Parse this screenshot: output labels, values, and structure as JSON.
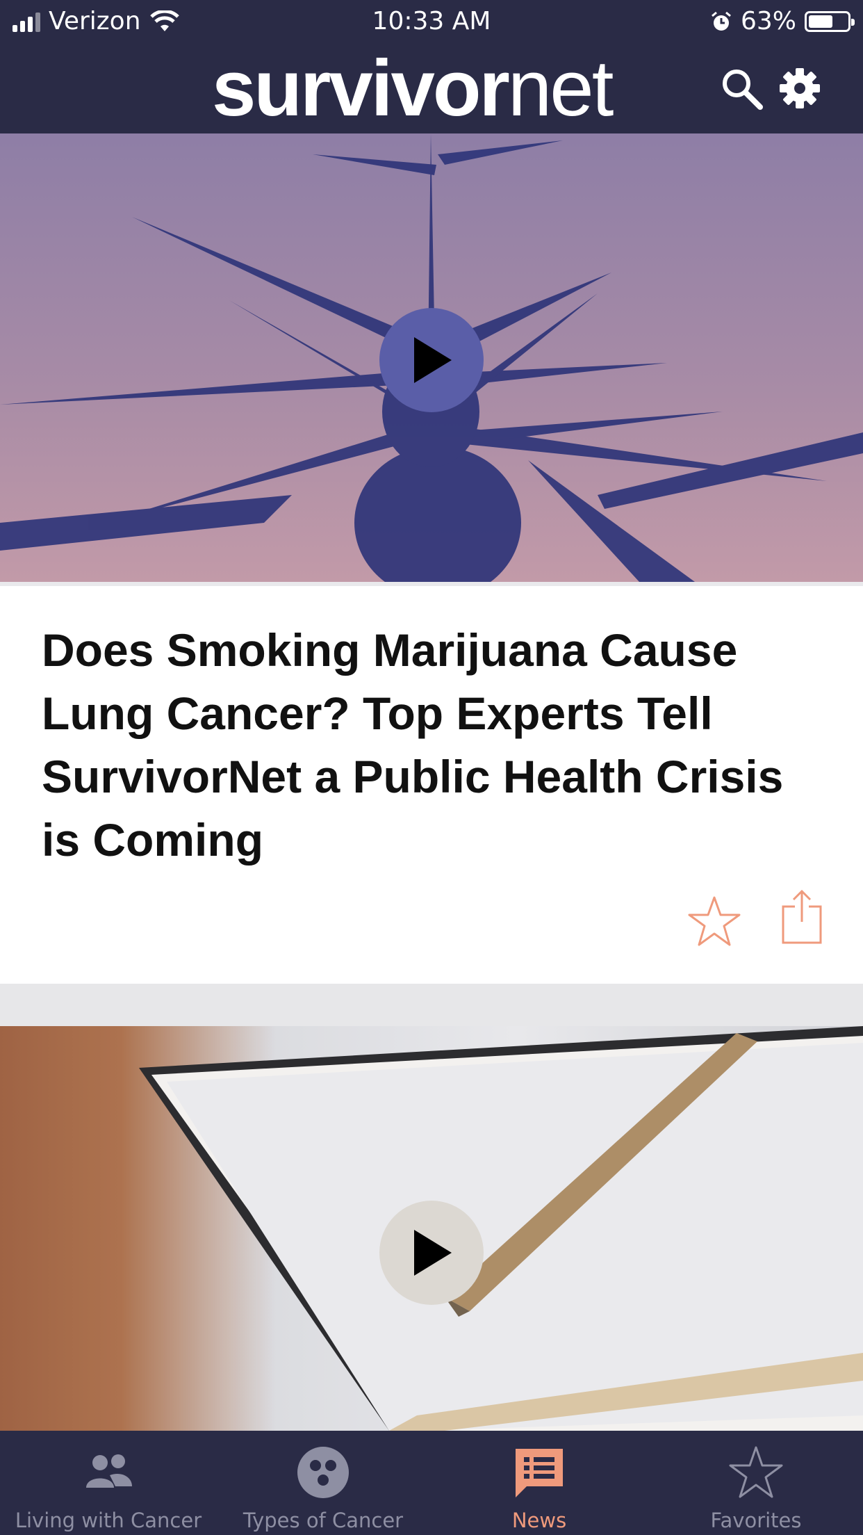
{
  "status_bar": {
    "carrier": "Verizon",
    "time": "10:33 AM",
    "battery_percent": "63%",
    "battery_level": 0.63
  },
  "header": {
    "logo_bold": "survivor",
    "logo_light": "net",
    "icons": [
      "search-icon",
      "gear-icon"
    ]
  },
  "articles": [
    {
      "title": "Does Smoking Marijuana Cause Lung Cancer? Top Experts Tell SurvivorNet a Public Health Crisis is Coming",
      "has_video": true,
      "actions": [
        "star-icon",
        "share-icon"
      ]
    },
    {
      "title": "",
      "has_video": true
    }
  ],
  "tabs": [
    {
      "label": "Living with Cancer",
      "icon": "people-icon",
      "active": false
    },
    {
      "label": "Types of Cancer",
      "icon": "cells-icon",
      "active": false
    },
    {
      "label": "News",
      "icon": "news-icon",
      "active": true
    },
    {
      "label": "Favorites",
      "icon": "star-icon",
      "active": false
    }
  ],
  "colors": {
    "nav_bg": "#2a2b46",
    "accent": "#ef9a7c",
    "inactive_tab": "#8e8fa3"
  }
}
